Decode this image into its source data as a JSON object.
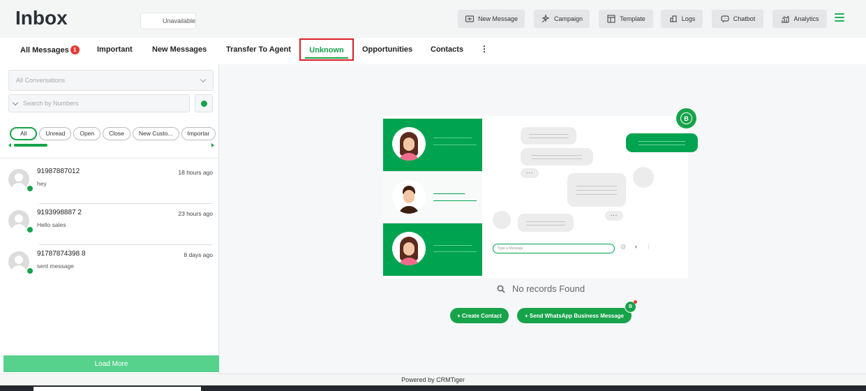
{
  "header": {
    "title": "Inbox",
    "status": "Unavailable",
    "buttons": [
      {
        "label": "New Message",
        "icon": "new-message-icon"
      },
      {
        "label": "Campaign",
        "icon": "campaign-icon"
      },
      {
        "label": "Template",
        "icon": "template-icon"
      },
      {
        "label": "Logs",
        "icon": "logs-icon"
      },
      {
        "label": "Chatbot",
        "icon": "chatbot-icon"
      },
      {
        "label": "Analytics",
        "icon": "analytics-icon"
      }
    ]
  },
  "tabs": {
    "all_messages": "All Messages",
    "all_messages_badge": "1",
    "important": "Important",
    "new_messages": "New Messages",
    "transfer": "Transfer To Agent",
    "unknown": "Unknown",
    "opportunities": "Opportunities",
    "contacts": "Contacts",
    "more": "⋮"
  },
  "sidebar": {
    "select_value": "All Conversations",
    "search_placeholder": "Search by Numbers",
    "filters": [
      "All",
      "Unread",
      "Open",
      "Close",
      "New Custo...",
      "Importar"
    ],
    "conversations": [
      {
        "number": "91987887012",
        "message": "hey",
        "time": "18 hours ago"
      },
      {
        "number": "9193998887 2",
        "message": "Hello sales",
        "time": "23 hours ago"
      },
      {
        "number": "91787874398 8",
        "message": "sent message",
        "time": "8 days ago"
      }
    ],
    "load_more": "Load More"
  },
  "main": {
    "type_placeholder": "Type a Message",
    "empty_text": "No records Found",
    "create_contact": "+ Create Contact",
    "send_whatsapp": "+ Send WhatsApp Business Message"
  },
  "footer": {
    "powered_by": "Powered by CRMTiger"
  },
  "colors": {
    "accent": "#16a34a",
    "brand_green": "#00a34f",
    "alert_red": "#e53935",
    "active_tab_border": "#d81f26",
    "load_more_green": "#57d28c"
  }
}
